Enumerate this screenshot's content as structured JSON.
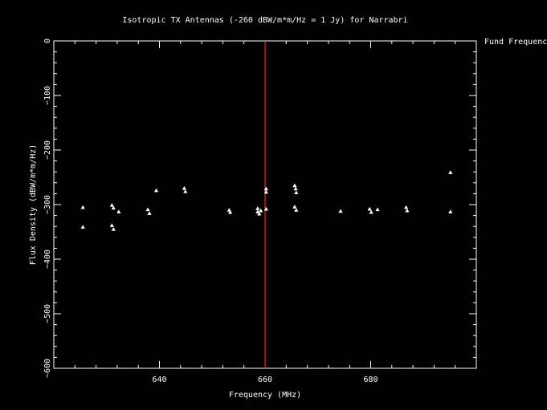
{
  "chart_data": {
    "type": "scatter",
    "title": "Isotropic TX Antennas (-260 dBW/m*m/Hz = 1 Jy) for Narrabri",
    "xlabel": "Frequency (MHz)",
    "ylabel": "Flux Density (dBW/m*m/Hz)",
    "xlim": [
      620,
      700
    ],
    "ylim": [
      -600,
      0
    ],
    "xticks": [
      640,
      660,
      680
    ],
    "yticks": [
      0,
      -100,
      -200,
      -300,
      -400,
      -500,
      -600
    ],
    "x_tick_labels": [
      "640",
      "660",
      "680"
    ],
    "y_tick_labels": [
      "0",
      "−100",
      "−200",
      "−300",
      "−400",
      "−500",
      "−600"
    ],
    "grid": false,
    "marker_line": {
      "label": "Fund Frequency",
      "x": 660,
      "color": "#ff2020"
    },
    "series": [
      {
        "marker": "triangle",
        "color": "#ffffff",
        "points": [
          [
            625.5,
            -305
          ],
          [
            625.5,
            -341
          ],
          [
            631,
            -301
          ],
          [
            631.3,
            -306
          ],
          [
            631,
            -338
          ],
          [
            631.3,
            -345
          ],
          [
            632.3,
            -313
          ],
          [
            637.8,
            -309
          ],
          [
            638.1,
            -316
          ],
          [
            639.4,
            -274
          ],
          [
            644.7,
            -270
          ],
          [
            644.9,
            -276
          ],
          [
            653.2,
            -310
          ],
          [
            653.4,
            -314
          ],
          [
            658.6,
            -307
          ],
          [
            658.6,
            -313
          ],
          [
            658.9,
            -317
          ],
          [
            659.2,
            -311
          ],
          [
            660.2,
            -271
          ],
          [
            660.2,
            -277
          ],
          [
            660.2,
            -308
          ],
          [
            665.6,
            -265
          ],
          [
            665.8,
            -271
          ],
          [
            665.9,
            -278
          ],
          [
            665.6,
            -304
          ],
          [
            665.9,
            -310
          ],
          [
            674.3,
            -312
          ],
          [
            679.8,
            -308
          ],
          [
            680.1,
            -314
          ],
          [
            681.3,
            -309
          ],
          [
            686.7,
            -305
          ],
          [
            686.9,
            -311
          ],
          [
            695.1,
            -241
          ],
          [
            695.1,
            -313
          ]
        ]
      }
    ]
  }
}
